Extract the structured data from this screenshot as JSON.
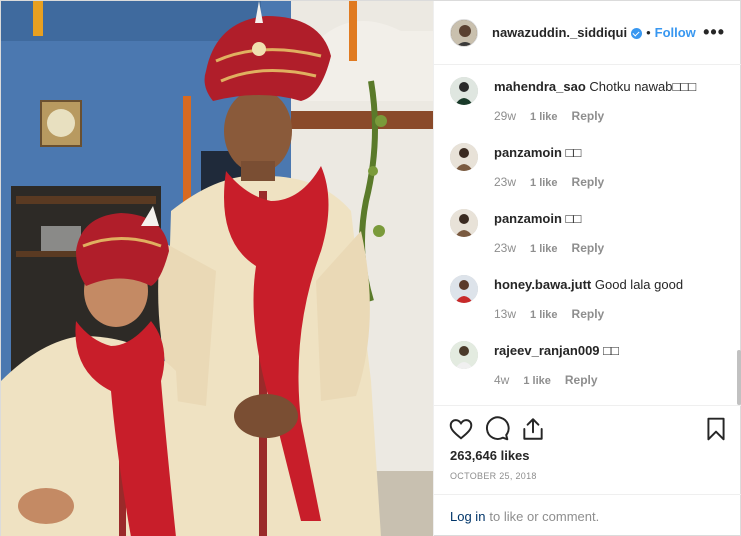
{
  "header": {
    "username": "nawazuddin._siddiqui",
    "separator": "•",
    "follow_label": "Follow",
    "more_label": "•••",
    "verified_icon": "verified-badge-icon"
  },
  "comments": [
    {
      "user": "mahendra_sao",
      "text": "Chotku nawab□□□",
      "age": "29w",
      "likes": "1 like",
      "reply": "Reply"
    },
    {
      "user": "panzamoin",
      "text": "□□",
      "age": "23w",
      "likes": "1 like",
      "reply": "Reply"
    },
    {
      "user": "panzamoin",
      "text": "□□",
      "age": "23w",
      "likes": "1 like",
      "reply": "Reply"
    },
    {
      "user": "honey.bawa.jutt",
      "text": "Good lala good",
      "age": "13w",
      "likes": "1 like",
      "reply": "Reply"
    },
    {
      "user": "rajeev_ranjan009",
      "text": "□□",
      "age": "4w",
      "likes": "1 like",
      "reply": "Reply"
    }
  ],
  "actions": {
    "like_icon": "heart-icon",
    "comment_icon": "comment-icon",
    "share_icon": "share-icon",
    "save_icon": "bookmark-icon",
    "likes_count": "263,646 likes",
    "date": "OCTOBER 25, 2018"
  },
  "login": {
    "login_label": "Log in",
    "suffix_text": "to like or comment."
  },
  "colors": {
    "accent": "#3897f0",
    "text": "#262626",
    "muted": "#8e8e8e",
    "link": "#003569",
    "border": "#efefef"
  }
}
